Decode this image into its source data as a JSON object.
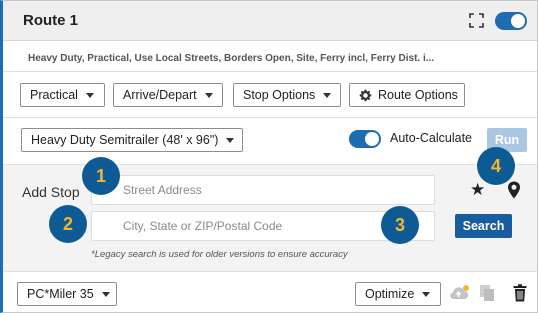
{
  "header": {
    "title": "Route 1",
    "icons": [
      "expand-icon",
      "toggle"
    ]
  },
  "summary": "Heavy Duty, Practical, Use Local Streets, Borders Open, Site, Ferry incl, Ferry Dist. i...",
  "toolbar": {
    "routing_type": "Practical",
    "arrive_depart": "Arrive/Depart",
    "stop_options": "Stop Options",
    "route_options": "Route Options"
  },
  "vehicle": {
    "profile": "Heavy Duty Semitrailer (48' x 96\")",
    "auto_calculate_label": "Auto-Calculate",
    "run_label": "Run"
  },
  "add_stop": {
    "label": "Add Stop",
    "street_placeholder": "Street Address",
    "city_placeholder": "City, State or ZIP/Postal Code",
    "search_label": "Search",
    "legacy_note": "*Legacy search is used for older versions to ensure accuracy"
  },
  "badges": [
    "1",
    "2",
    "3",
    "4"
  ],
  "footer": {
    "version": "PC*Miler 35",
    "optimize": "Optimize"
  },
  "colors": {
    "accent": "#1e6db3",
    "badge_bg": "#0d5a94",
    "badge_text": "#f2b632",
    "run_disabled": "#a9c7e3"
  }
}
